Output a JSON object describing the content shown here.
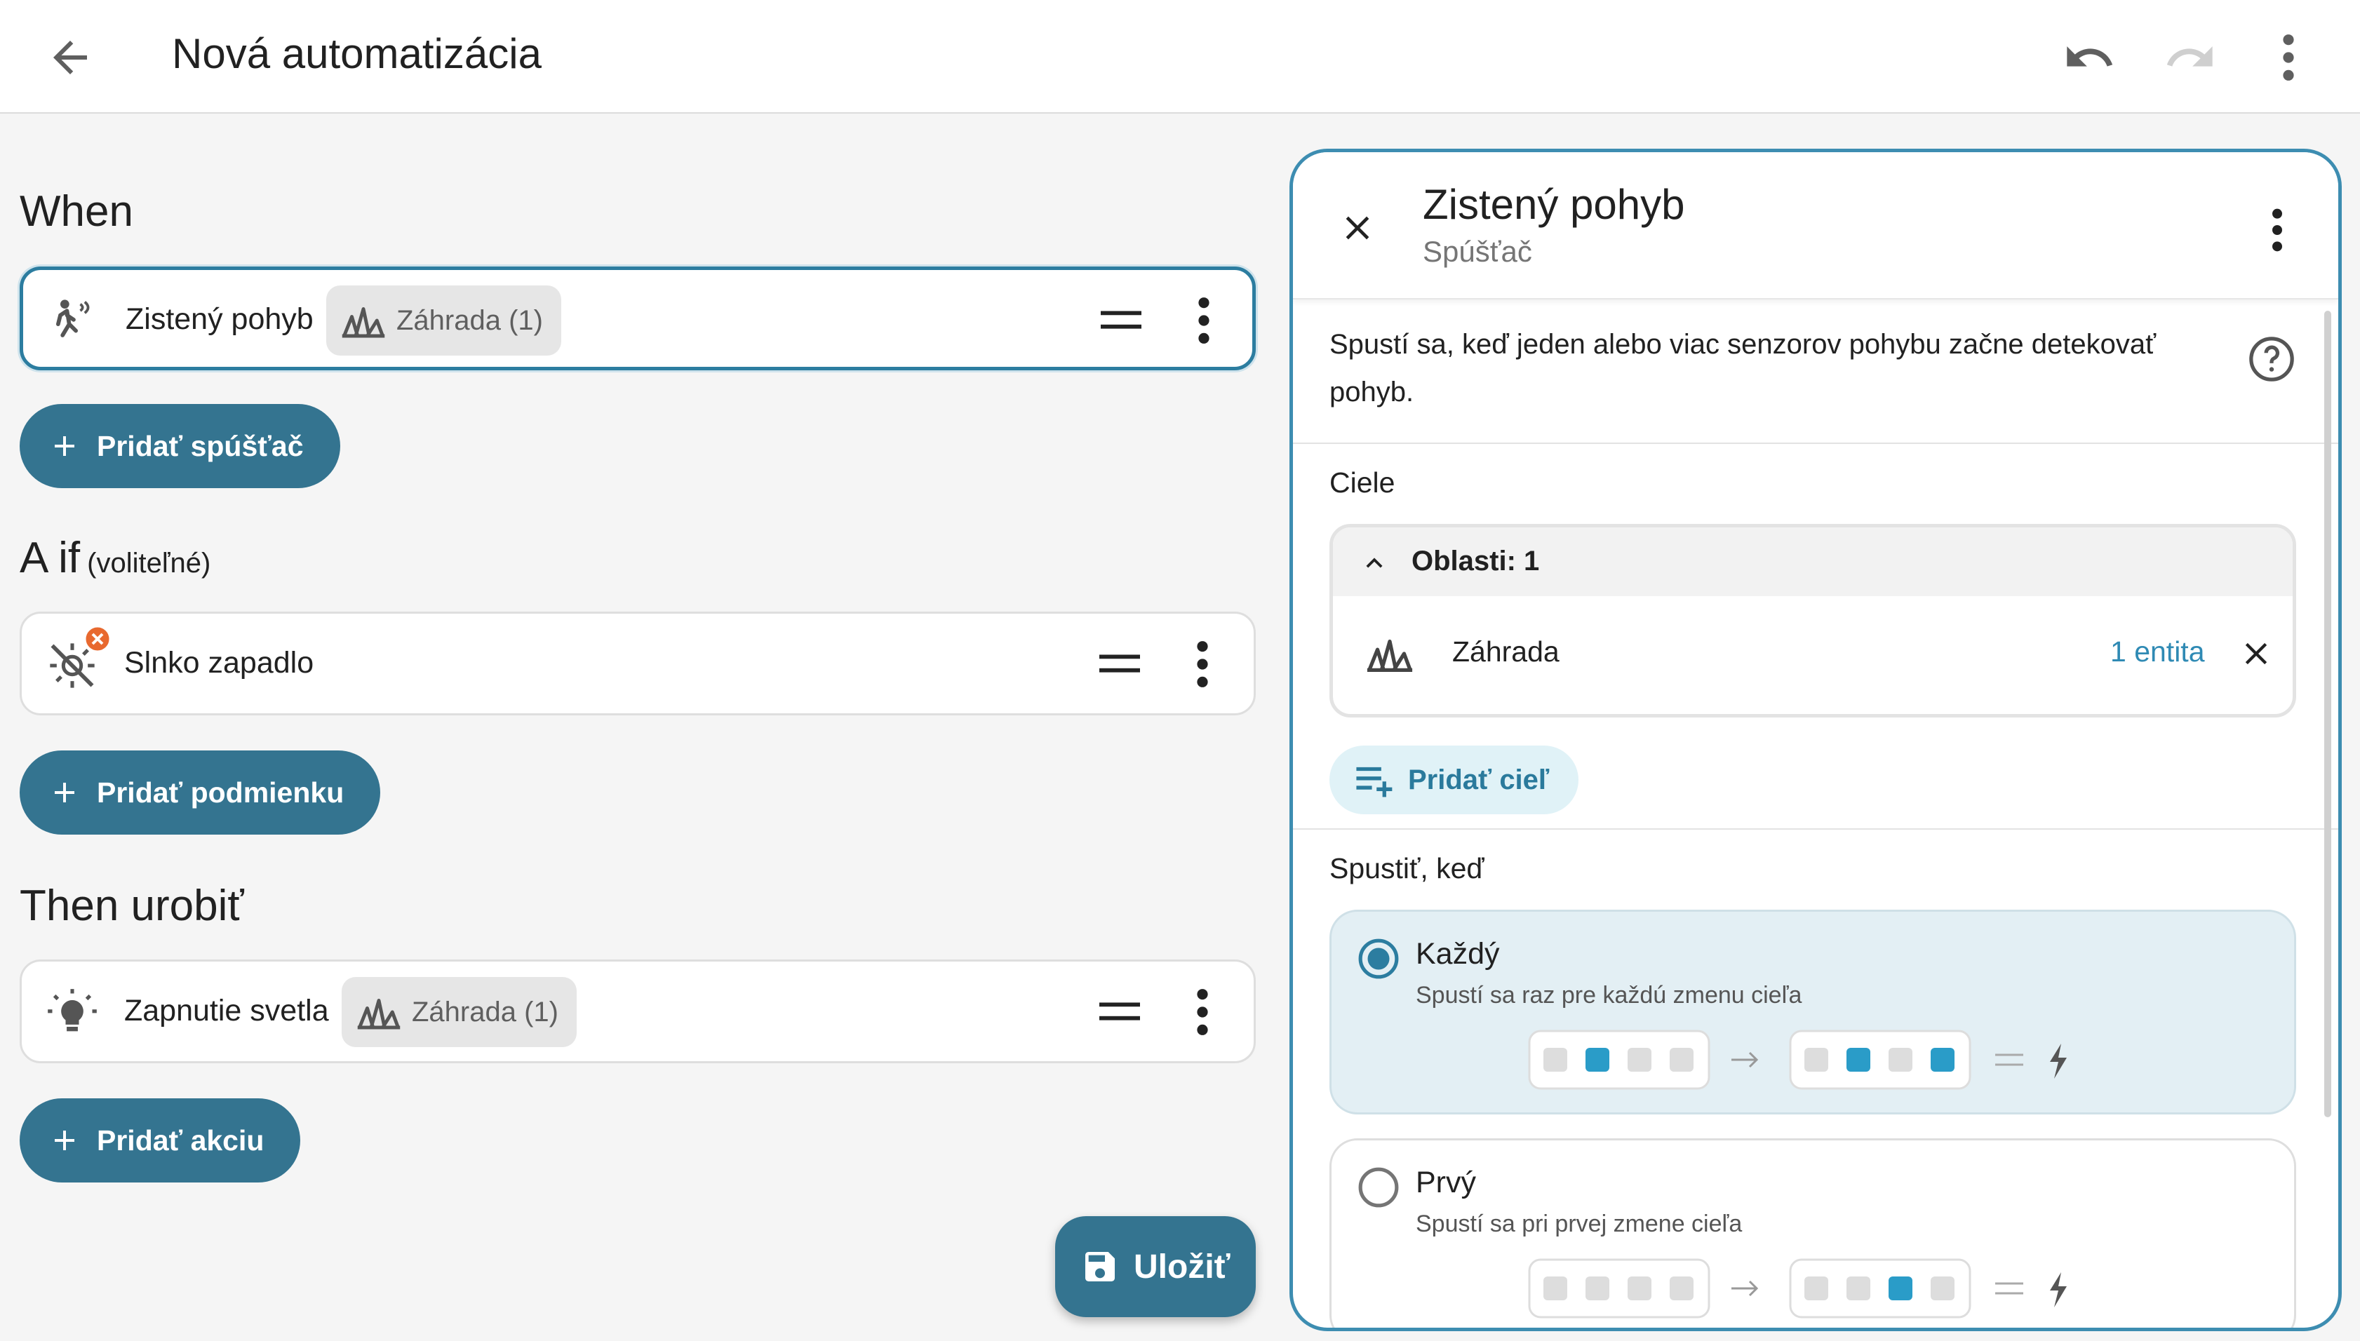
{
  "topbar": {
    "title": "Nová automatizácia",
    "back_icon": "arrow-left-icon",
    "undo_icon": "undo-icon",
    "redo_icon": "redo-icon",
    "more_icon": "dots-vertical-icon"
  },
  "when": {
    "title": "When",
    "trigger": {
      "label": "Zistený pohyb",
      "icon": "motion-sensor-icon",
      "chip": "Záhrada (1)"
    },
    "add_label": "Pridať spúšťač"
  },
  "if": {
    "title": "A if",
    "optional": "(voliteľné)",
    "condition": {
      "label": "Slnko zapadlo",
      "icon": "sun-off-icon"
    },
    "add_label": "Pridať podmienku"
  },
  "then": {
    "title": "Then urobiť",
    "action": {
      "label": "Zapnutie svetla",
      "icon": "lightbulb-icon",
      "chip": "Záhrada (1)"
    },
    "add_label": "Pridať akciu"
  },
  "save_label": "Uložiť",
  "panel": {
    "title": "Zistený pohyb",
    "subtitle": "Spúšťač",
    "description": "Spustí sa, keď jeden alebo viac senzorov pohybu začne detekovať pohyb.",
    "targets_label": "Ciele",
    "areas_header": "Oblasti: 1",
    "area": {
      "name": "Záhrada",
      "count": "1 entita"
    },
    "add_target_label": "Pridať cieľ",
    "trigger_when_label": "Spustiť, keď",
    "options": [
      {
        "name": "Každý",
        "desc": "Spustí sa raz pre každú zmenu cieľa",
        "selected": true
      },
      {
        "name": "Prvý",
        "desc": "Spustí sa pri prvej zmene cieľa",
        "selected": false
      }
    ]
  },
  "colors": {
    "accent": "#347490",
    "selected_border": "#2c7da0",
    "link": "#2f8ab4",
    "error_badge": "#e8692f",
    "illustration_active": "#2a9cc8",
    "illustration_inactive": "#dddddd"
  }
}
